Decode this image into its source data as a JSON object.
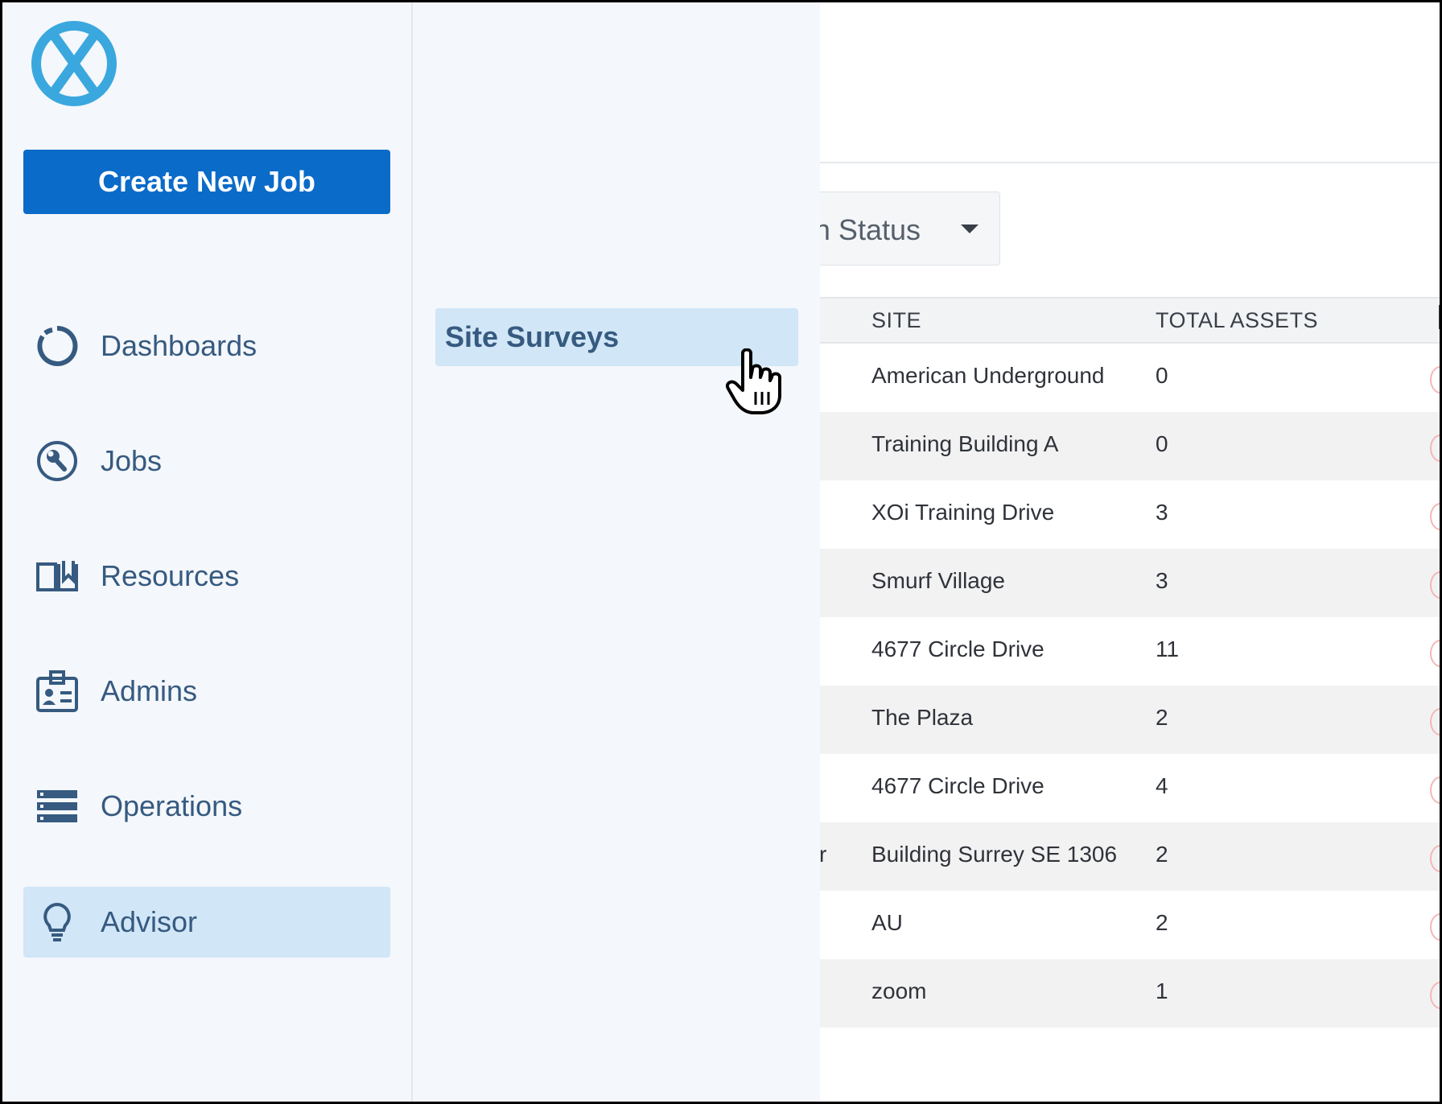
{
  "nav": {
    "create_button": "Create New Job",
    "items": [
      {
        "label": "Dashboards",
        "icon": "dashboard-ring-icon"
      },
      {
        "label": "Jobs",
        "icon": "wrench-circle-icon"
      },
      {
        "label": "Resources",
        "icon": "open-book-icon"
      },
      {
        "label": "Admins",
        "icon": "id-badge-icon"
      },
      {
        "label": "Operations",
        "icon": "list-server-icon"
      },
      {
        "label": "Advisor",
        "icon": "lightbulb-icon",
        "active": true
      }
    ]
  },
  "subnav": {
    "items": [
      {
        "label": "Site Surveys",
        "active": true
      }
    ]
  },
  "filter": {
    "label_visible": "n Status"
  },
  "table": {
    "headers": {
      "site": "SITE",
      "total_assets": "TOTAL ASSETS"
    },
    "rows": [
      {
        "site": "American Underground",
        "total_assets": "0"
      },
      {
        "site": "Training Building A",
        "total_assets": "0"
      },
      {
        "site": "XOi Training Drive",
        "total_assets": "3"
      },
      {
        "site": "Smurf Village",
        "total_assets": "3"
      },
      {
        "site": "4677 Circle Drive",
        "total_assets": "11"
      },
      {
        "site": "The Plaza",
        "total_assets": "2"
      },
      {
        "site": "4677 Circle Drive",
        "total_assets": "4"
      },
      {
        "site": "Building Surrey SE 1306",
        "total_assets": "2",
        "left_trunc": "r"
      },
      {
        "site": "AU",
        "total_assets": "2"
      },
      {
        "site": "zoom",
        "total_assets": "1"
      }
    ]
  },
  "colors": {
    "primary": "#0a6bc9",
    "nav_text": "#365a80",
    "active_bg": "#d1e6f7",
    "drawer_bg": "#f4f7fb",
    "logo": "#3aa8de"
  }
}
